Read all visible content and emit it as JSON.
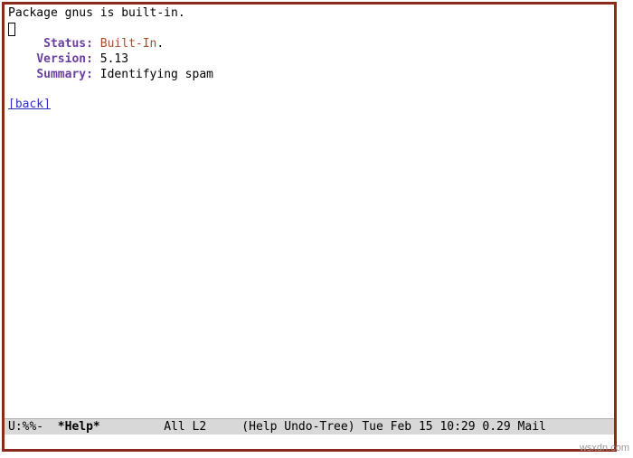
{
  "header": {
    "package_line": "Package gnus is built-in."
  },
  "fields": {
    "status_label": "Status:",
    "status_value": "Built-In",
    "status_punct": ".",
    "version_label": "Version:",
    "version_value": "5.13",
    "summary_label": "Summary:",
    "summary_value": "Identifying spam"
  },
  "back_link": "[back]",
  "modeline": {
    "left": "U:%%-  ",
    "buffer": "*Help*",
    "mid": "         All L2     (Help Undo-Tree) Tue Feb 15 10:29 0.29 Mail"
  },
  "watermark": "wsxdn.com"
}
